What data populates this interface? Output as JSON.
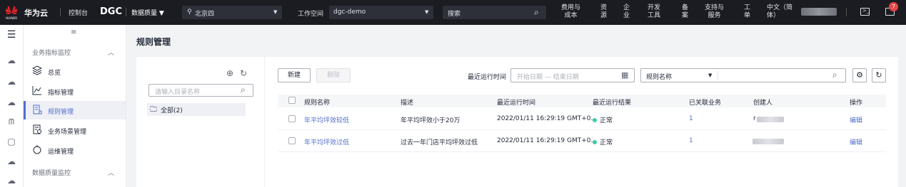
{
  "topbar": {
    "brand": "华为云",
    "console": "控制台",
    "product": "DGC",
    "module": "数据质量 ▼",
    "region": "北京四",
    "workspace_label": "工作空间",
    "workspace": "dgc-demo",
    "search_placeholder": "搜索",
    "nav": [
      {
        "l1": "费用与",
        "l2": "成本"
      },
      {
        "l1": "资",
        "l2": "源"
      },
      {
        "l1": "企",
        "l2": "业"
      },
      {
        "l1": "开发",
        "l2": "工具"
      },
      {
        "l1": "备",
        "l2": "案"
      },
      {
        "l1": "支持与",
        "l2": "服务"
      },
      {
        "l1": "工",
        "l2": "单"
      },
      {
        "l1": "中文（简",
        "l2": "体）"
      }
    ],
    "notification_count": "7"
  },
  "nav": {
    "group1": "业务指标监控",
    "items": [
      {
        "label": "总览",
        "icon": "layers-icon"
      },
      {
        "label": "指标管理",
        "icon": "line-chart-icon"
      },
      {
        "label": "规则管理",
        "icon": "rule-icon"
      },
      {
        "label": "业务场景管理",
        "icon": "scenario-icon"
      },
      {
        "label": "运维管理",
        "icon": "operations-icon"
      }
    ],
    "group2": "数据质量监控"
  },
  "page": {
    "title": "规则管理"
  },
  "tree": {
    "search_placeholder": "请输入目录名称",
    "root_node": "全部(2)"
  },
  "toolbar": {
    "new_label": "新建",
    "delete_label": "删除",
    "last_run_label": "最近运行时间",
    "date_placeholder": "开始日期 — 结束日期",
    "filter_field": "规则名称"
  },
  "table": {
    "columns": [
      "规则名称",
      "描述",
      "最近运行时间",
      "最近运行结果",
      "已关联业务",
      "创建人",
      "操作"
    ],
    "rows": [
      {
        "name": "年平均坪效较低",
        "desc": "年平均坪效小于20万",
        "time": "2022/01/11 16:29:19 GMT+0...",
        "result": "正常",
        "linked": "1",
        "creator_prefix": "r",
        "action": "编辑"
      },
      {
        "name": "年平均坪效过低",
        "desc": "过去一年门店平均坪效过低",
        "time": "2022/01/11 16:29:19 GMT+0...",
        "result": "正常",
        "linked": "1",
        "creator_prefix": "",
        "action": "编辑"
      }
    ]
  },
  "colors": {
    "accent": "#526ecc",
    "topbar": "#1a1c22",
    "success": "#3dcca6",
    "badge": "#e54545"
  }
}
